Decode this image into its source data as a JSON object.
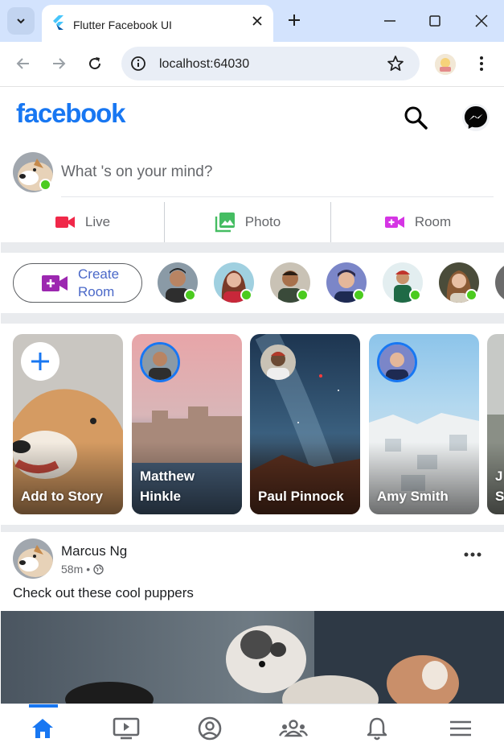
{
  "browser": {
    "tab_title": "Flutter Facebook UI",
    "url": "localhost:64030",
    "icons": [
      "tab-search-icon",
      "flutter-icon",
      "close-icon",
      "plus-icon",
      "minimize-icon",
      "maximize-icon",
      "close-window-icon",
      "back-icon",
      "forward-icon",
      "reload-icon",
      "site-info-icon",
      "bookmark-star-icon",
      "profile-icon",
      "kebab-menu-icon"
    ]
  },
  "app": {
    "logo": "facebook",
    "brand_color": "#1877f2",
    "online_color": "#4bcb1f",
    "composer": {
      "placeholder": "What 's on your mind?"
    },
    "actions": [
      {
        "label": "Live",
        "icon": "videocam-icon",
        "color": "#f02849"
      },
      {
        "label": "Photo",
        "icon": "photo-library-icon",
        "color": "#45bd62"
      },
      {
        "label": "Room",
        "icon": "video-call-icon",
        "color": "#d535e4"
      }
    ],
    "rooms": {
      "create_label": "Create Room"
    },
    "stories": [
      {
        "name": "Add to Story"
      },
      {
        "name": "Matthew Hinkle"
      },
      {
        "name": "Paul Pinnock"
      },
      {
        "name": "Amy Smith"
      },
      {
        "name": "J S"
      }
    ],
    "post": {
      "author": "Marcus Ng",
      "time": "58m",
      "separator": "•",
      "caption": "Check out these cool puppers"
    },
    "bottom_nav": [
      "home-icon",
      "ondemand-video-icon",
      "account-circle-icon",
      "groups-icon",
      "notifications-icon",
      "menu-icon"
    ]
  }
}
